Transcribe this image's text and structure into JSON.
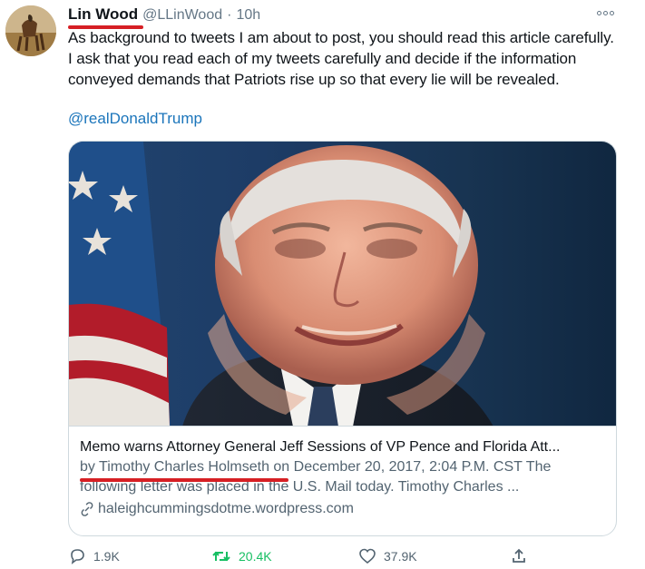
{
  "author": {
    "name": "Lin Wood",
    "handle": "@LLinWood",
    "separator": "·",
    "time": "10h"
  },
  "tweet": {
    "text": "As background to tweets I am about to post, you should read this article carefully. I ask that you read each of my tweets carefully and decide if the information conveyed demands that Patriots rise up so that every lie will be revealed.",
    "mention": "@realDonaldTrump"
  },
  "card": {
    "title": "Memo warns Attorney General Jeff Sessions of VP Pence and Florida Att...",
    "description": "by Timothy Charles Holmseth on December 20, 2017, 2:04 P.M. CST The following letter was placed in the U.S. Mail today. Timothy Charles ...",
    "domain": "haleighcummingsdotme.wordpress.com"
  },
  "actions": {
    "reply_count": "1.9K",
    "retweet_count": "20.4K",
    "like_count": "37.9K"
  },
  "icons": {
    "more": "more-icon",
    "reply": "reply-icon",
    "retweet": "retweet-icon",
    "like": "heart-icon",
    "share": "share-icon",
    "link": "link-icon"
  },
  "colors": {
    "text": "#0f1419",
    "secondary": "#657786",
    "link": "#1b75bb",
    "retweet": "#17bf63",
    "annotation_underline": "#d61f24"
  }
}
